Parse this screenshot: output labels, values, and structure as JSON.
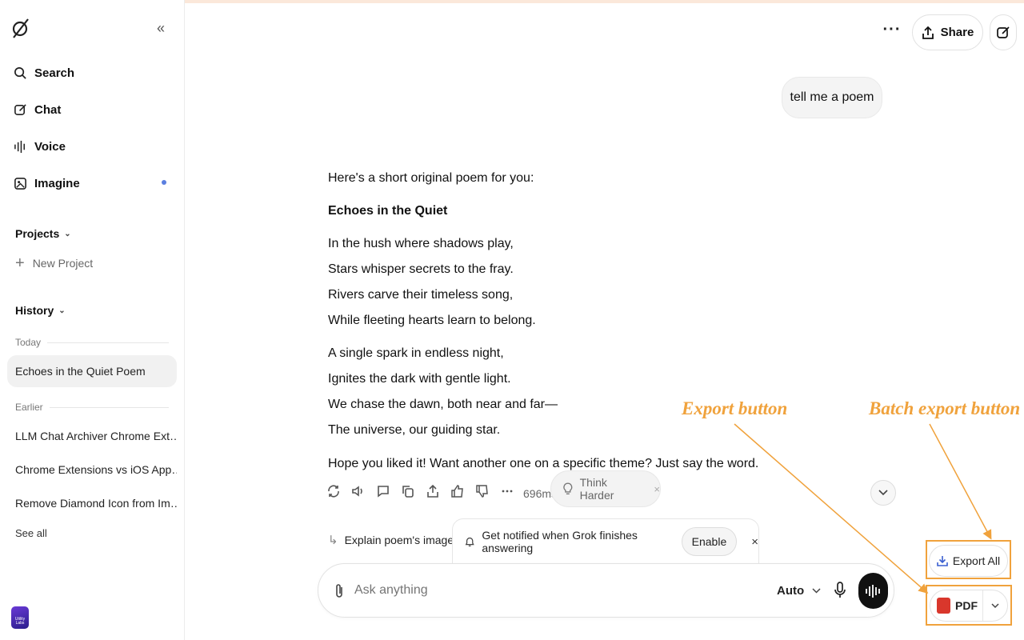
{
  "sidebar": {
    "nav": [
      {
        "label": "Search",
        "icon": "search-icon"
      },
      {
        "label": "Chat",
        "icon": "edit-icon"
      },
      {
        "label": "Voice",
        "icon": "voice-icon"
      },
      {
        "label": "Imagine",
        "icon": "image-icon"
      }
    ],
    "projects_label": "Projects",
    "new_project_label": "New Project",
    "history_label": "History",
    "today_label": "Today",
    "today_items": [
      "Echoes in the Quiet Poem"
    ],
    "earlier_label": "Earlier",
    "earlier_items": [
      "LLM Chat Archiver Chrome Ext…",
      "Chrome Extensions vs iOS App…",
      "Remove Diamond Icon from Im…"
    ],
    "see_all_label": "See all",
    "ext_logo_text": "Utility Labs"
  },
  "topbar": {
    "share_label": "Share"
  },
  "chat": {
    "user_message": "tell me a poem",
    "intro": "Here's a short original poem for you:",
    "poem_title": "Echoes in the Quiet",
    "stanza1": [
      "In the hush where shadows play,",
      "Stars whisper secrets to the fray.",
      "Rivers carve their timeless song,",
      "While fleeting hearts learn to belong."
    ],
    "stanza2": [
      "A single spark in endless night,",
      "Ignites the dark with gentle light.",
      "We chase the dawn, both near and far—",
      "The universe, our guiding star."
    ],
    "closing": "Hope you liked it! Want another one on a specific theme? Just say the word.",
    "timing": "696ms",
    "think_harder_label": "Think Harder",
    "suggestion": "Explain poem's imagery"
  },
  "notify": {
    "text": "Get notified when Grok finishes answering",
    "enable_label": "Enable"
  },
  "composer": {
    "placeholder": "Ask anything",
    "mode": "Auto"
  },
  "annotations": {
    "export_label": "Export button",
    "batch_label": "Batch export button",
    "color": "#f0a23c"
  },
  "export": {
    "export_all_label": "Export All",
    "pdf_label": "PDF"
  }
}
